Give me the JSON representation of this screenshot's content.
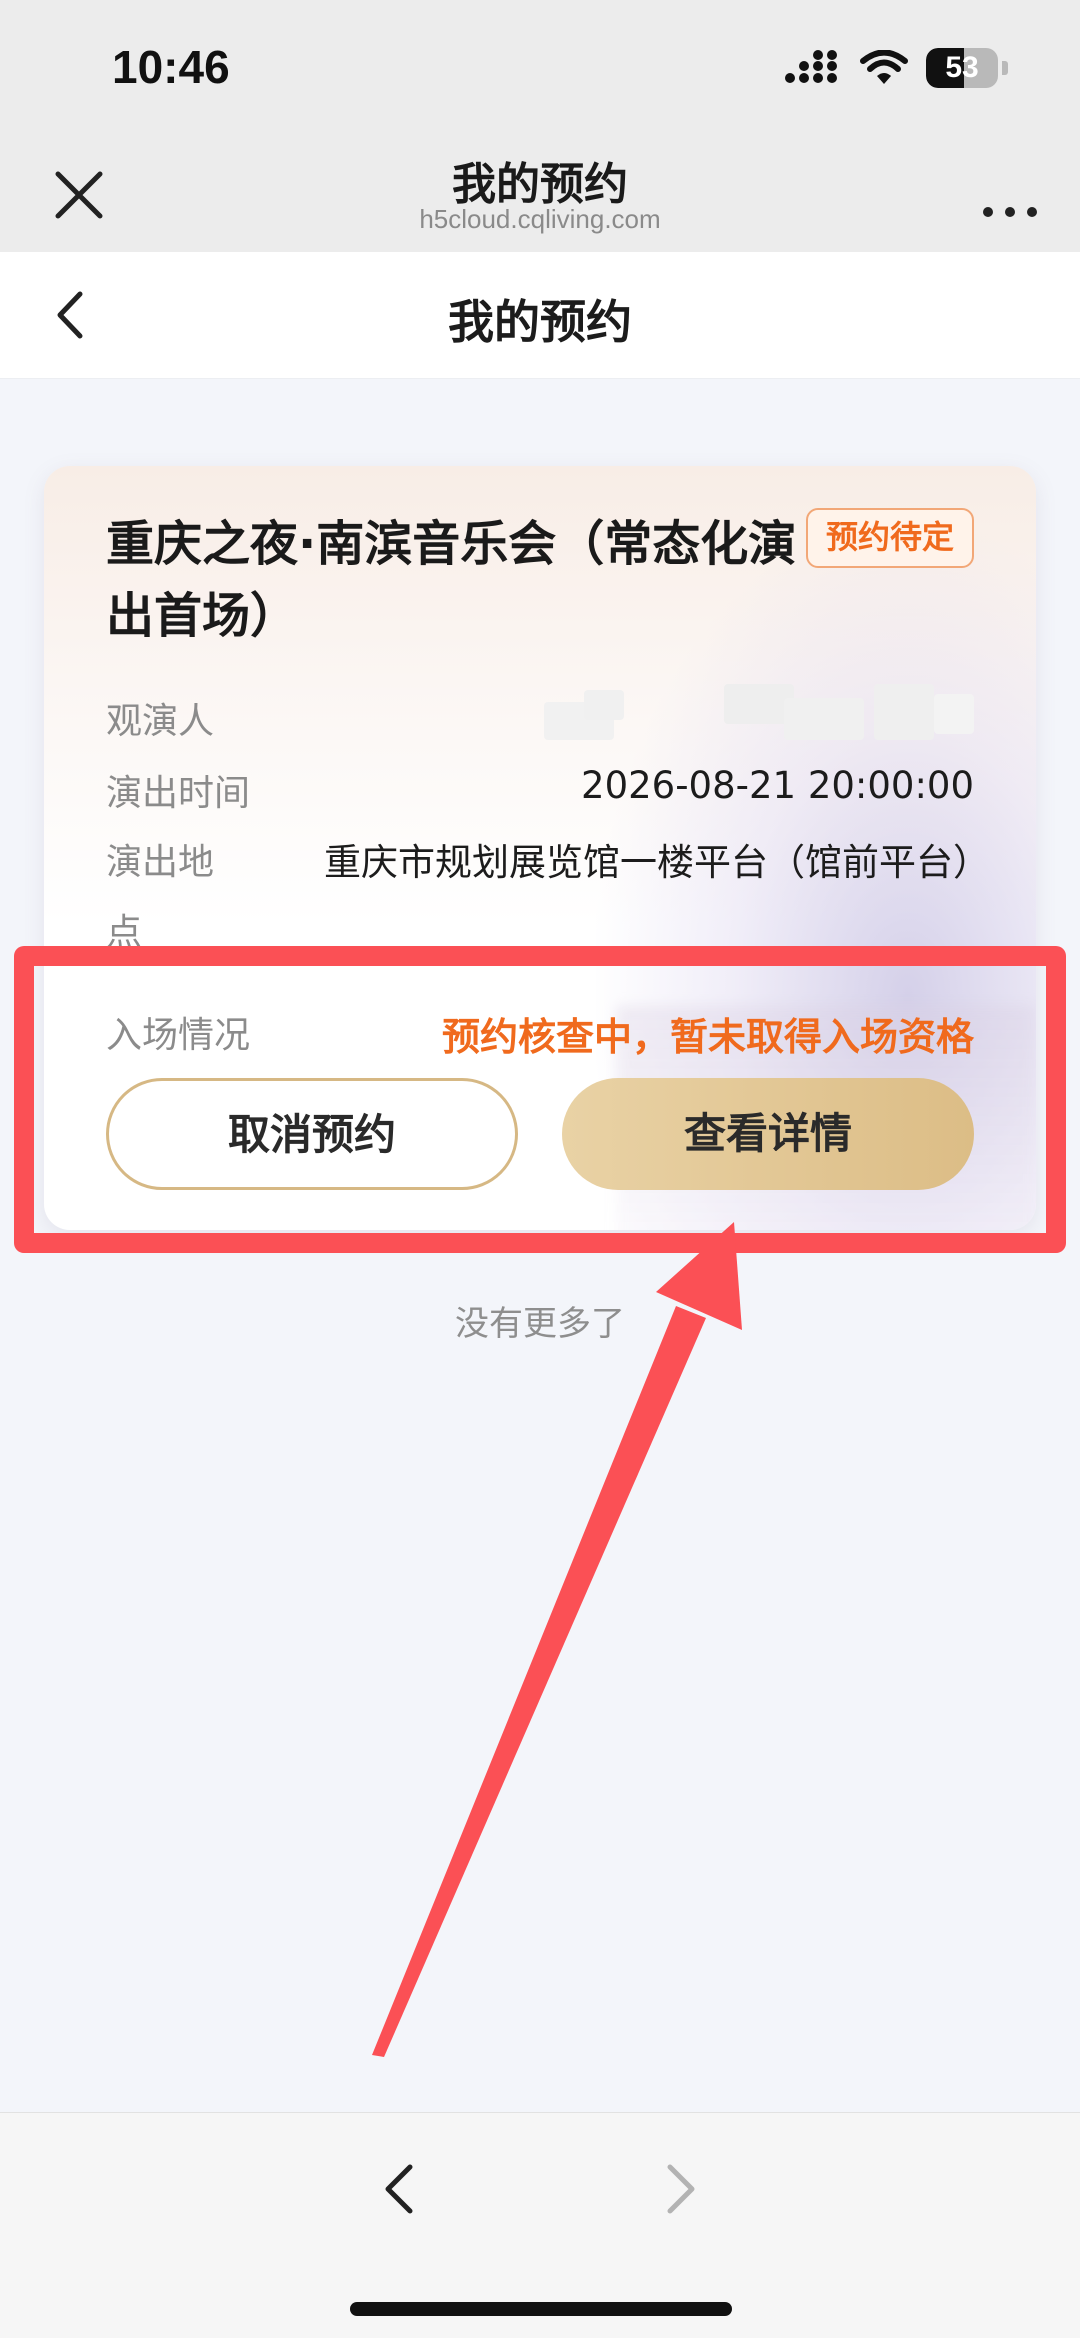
{
  "status_bar": {
    "time": "10:46",
    "battery": "53",
    "battery_level": 0.53
  },
  "browser": {
    "title": "我的预约",
    "url": "h5cloud.cqliving.com"
  },
  "page": {
    "title": "我的预约"
  },
  "reservation": {
    "event_title": "重庆之夜·南滨音乐会（常态化演出首场）",
    "status_badge": "预约待定",
    "audience_label": "观演人",
    "time_label": "演出时间",
    "time_value": "2026-08-21 20:00:00",
    "location_label": "演出地点",
    "location_value": "重庆市规划展览馆一楼平台（馆前平台）",
    "entry_label": "入场情况",
    "entry_value": "预约核查中，暂未取得入场资格",
    "cancel_button": "取消预约",
    "detail_button": "查看详情"
  },
  "footer_note": "没有更多了",
  "colors": {
    "accent_orange": "#f06a1d",
    "gold": "#dcbd86",
    "annotation_red": "#fb5055"
  }
}
